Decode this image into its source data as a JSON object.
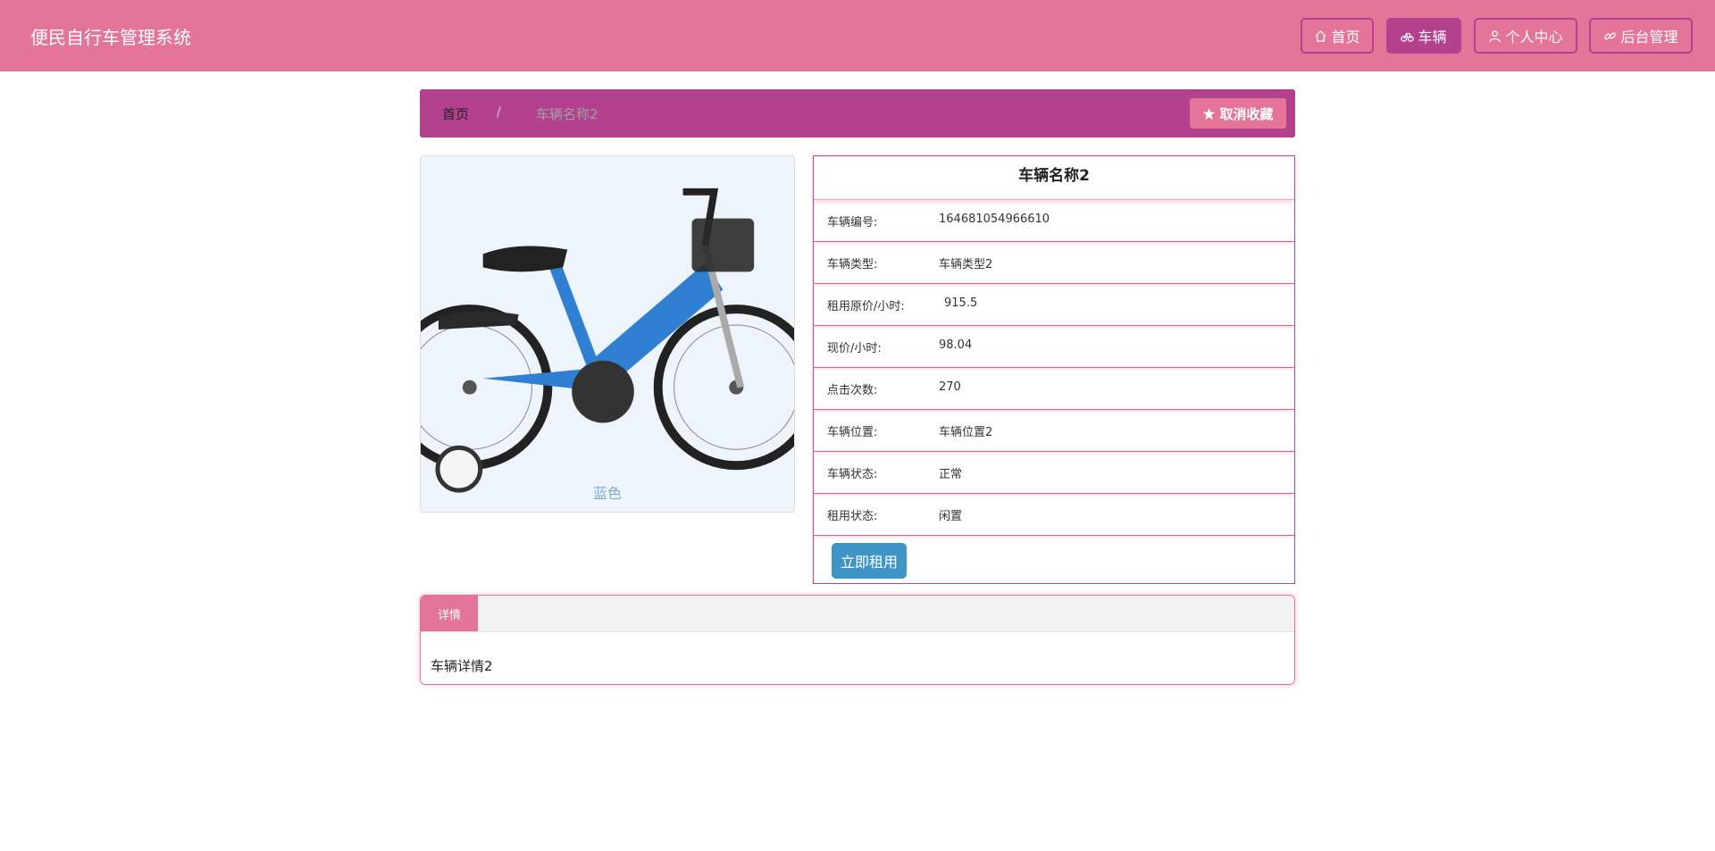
{
  "header": {
    "app_title": "便民自行车管理系统",
    "nav": [
      {
        "label": "首页",
        "icon": "home-icon",
        "active": false
      },
      {
        "label": "车辆",
        "icon": "bike-icon",
        "active": true
      },
      {
        "label": "个人中心",
        "icon": "user-icon",
        "active": false
      },
      {
        "label": "后台管理",
        "icon": "link-icon",
        "active": false
      }
    ]
  },
  "breadcrumb": {
    "home": "首页",
    "separator": "/",
    "current": "车辆名称2",
    "favorite_button": "取消收藏",
    "favorite_icon": "star-icon"
  },
  "vehicle": {
    "name": "车辆名称2",
    "image_caption": "蓝色",
    "fields": [
      {
        "label": "车辆编号:",
        "value": "164681054966610"
      },
      {
        "label": "车辆类型:",
        "value": "车辆类型2"
      },
      {
        "label": "租用原价/小时:",
        "value": "915.5"
      },
      {
        "label": "现价/小时:",
        "value": "98.04"
      },
      {
        "label": "点击次数:",
        "value": "270"
      },
      {
        "label": "车辆位置:",
        "value": "车辆位置2"
      },
      {
        "label": "车辆状态:",
        "value": "正常"
      },
      {
        "label": "租用状态:",
        "value": "闲置"
      }
    ],
    "rent_button": "立即租用"
  },
  "details": {
    "tab_label": "详情",
    "content": "车辆详情2"
  },
  "colors": {
    "header_bg": "#e57598",
    "accent": "#b3418e",
    "rent_button": "#3e95c5"
  }
}
